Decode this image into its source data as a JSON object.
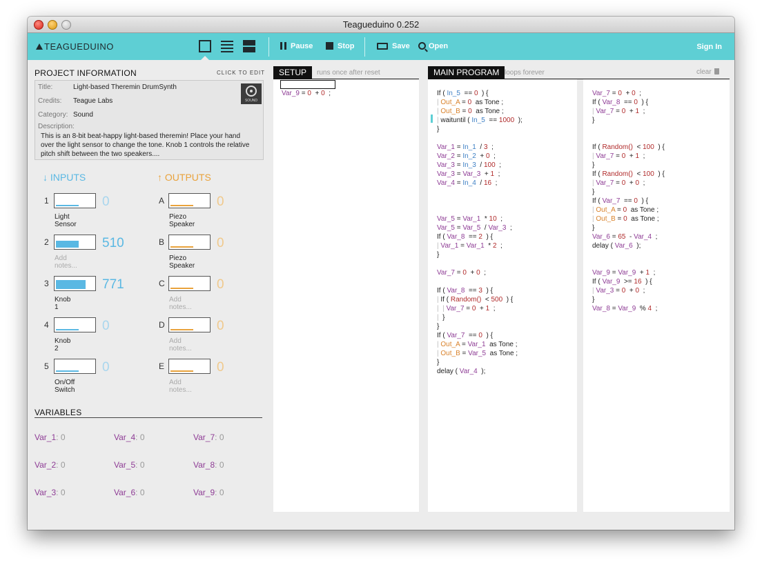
{
  "window": {
    "title": "Teagueduino 0.252"
  },
  "toolbar": {
    "logo": "TEAGUEDUINO",
    "pause": "Pause",
    "stop": "Stop",
    "save": "Save",
    "open": "Open",
    "signin": "Sign In",
    "icons": [
      "view-single-icon",
      "view-list-icon",
      "view-split-icon",
      "pause-icon",
      "stop-icon",
      "keyboard-icon",
      "search-icon"
    ]
  },
  "project": {
    "heading": "PROJECT INFORMATION",
    "edit_link": "CLICK TO EDIT",
    "title_label": "Title:",
    "title": "Light-based Theremin DrumSynth",
    "credits_label": "Credits:",
    "credits": "Teague Labs",
    "category_label": "Category:",
    "category": "Sound",
    "description_label": "Description:",
    "description": "This is an 8-bit beat-happy light-based theremin! Place your hand over the light sensor to change the tone. Knob 1 controls the relative pitch shift between the two speakers....",
    "category_icon_label": "SOUND"
  },
  "inputs": {
    "heading": "↓ INPUTS",
    "items": [
      {
        "id": "1",
        "value": "0",
        "fill": 0,
        "note": "Light Sensor",
        "note_set": true
      },
      {
        "id": "2",
        "value": "510",
        "fill": 0.5,
        "note": "Add notes...",
        "note_set": false
      },
      {
        "id": "3",
        "value": "771",
        "fill": 0.75,
        "note": "Knob 1",
        "note_set": true
      },
      {
        "id": "4",
        "value": "0",
        "fill": 0,
        "note": "Knob 2",
        "note_set": true
      },
      {
        "id": "5",
        "value": "0",
        "fill": 0,
        "note": "On/Off Switch",
        "note_set": true
      }
    ]
  },
  "outputs": {
    "heading": "↑ OUTPUTS",
    "items": [
      {
        "id": "A",
        "value": "0",
        "note": "Piezo Speaker",
        "note_set": true
      },
      {
        "id": "B",
        "value": "0",
        "note": "Piezo Speaker",
        "note_set": true
      },
      {
        "id": "C",
        "value": "0",
        "note": "Add notes...",
        "note_set": false
      },
      {
        "id": "D",
        "value": "0",
        "note": "Add notes...",
        "note_set": false
      },
      {
        "id": "E",
        "value": "0",
        "note": "Add notes...",
        "note_set": false
      }
    ]
  },
  "variables": {
    "heading": "VARIABLES",
    "items": [
      {
        "name": "Var_1",
        "value": "0"
      },
      {
        "name": "Var_4",
        "value": "0"
      },
      {
        "name": "Var_7",
        "value": "0"
      },
      {
        "name": "Var_2",
        "value": "0"
      },
      {
        "name": "Var_5",
        "value": "0"
      },
      {
        "name": "Var_8",
        "value": "0"
      },
      {
        "name": "Var_3",
        "value": "0"
      },
      {
        "name": "Var_6",
        "value": "0"
      },
      {
        "name": "Var_9",
        "value": "0"
      }
    ]
  },
  "setup": {
    "tab": "SETUP",
    "subtitle": "runs once after reset",
    "lines": [
      "<span class='p'>Var_9</span> = <span class='n'>0</span>  + <span class='n'>0</span>  ;"
    ]
  },
  "main": {
    "tab": "MAIN PROGRAM",
    "subtitle": "loops forever",
    "clear": "clear"
  },
  "main_col1": [
    "If ( <span class='b'>In_5</span>  == <span class='n'>0</span>  ) {",
    "<span class='g'>|</span> <span class='o'>Out_A</span> = <span class='n'>0</span>  as Tone ;",
    "<span class='g'>|</span> <span class='o'>Out_B</span> = <span class='n'>0</span>  as Tone ;",
    "<span class='g'>|</span> waituntil ( <span class='b'>In_5</span>  == <span class='n'>1000</span>  );",
    "}",
    "",
    "<span class='p'>Var_1</span> = <span class='b'>In_1</span>  / <span class='n'>3</span>  ;",
    "<span class='p'>Var_2</span> = <span class='b'>In_2</span>  + <span class='n'>0</span>  ;",
    "<span class='p'>Var_3</span> = <span class='b'>In_3</span>  / <span class='n'>100</span>  ;",
    "<span class='p'>Var_3</span> = <span class='p'>Var_3</span>  + <span class='n'>1</span>  ;",
    "<span class='p'>Var_4</span> = <span class='b'>In_4</span>  / <span class='n'>16</span>  ;",
    "",
    "",
    "",
    "<span class='p'>Var_5</span> = <span class='p'>Var_1</span>  * <span class='n'>10</span>  ;",
    "<span class='p'>Var_5</span> = <span class='p'>Var_5</span>  / <span class='p'>Var_3</span>  ;",
    "If ( <span class='p'>Var_8</span>  == <span class='n'>2</span>  ) {",
    "<span class='g'>|</span> <span class='p'>Var_1</span> = <span class='p'>Var_1</span>  * <span class='n'>2</span>  ;",
    "}",
    "",
    "<span class='p'>Var_7</span> = <span class='n'>0</span>  + <span class='n'>0</span>  ;",
    "",
    "If ( <span class='p'>Var_8</span>  == <span class='n'>3</span>  ) {",
    "<span class='g'>|</span> If ( <span class='n'>Random()</span>  &lt; <span class='n'>500</span>  ) {",
    "<span class='g'>|</span>  <span class='g'>|</span> <span class='p'>Var_7</span> = <span class='n'>0</span>  + <span class='n'>1</span>  ;",
    "<span class='g'>|</span>  }",
    "}",
    "If ( <span class='p'>Var_7</span>  == <span class='n'>0</span>  ) {",
    "<span class='g'>|</span> <span class='o'>Out_A</span> = <span class='p'>Var_1</span>  as Tone ;",
    "<span class='g'>|</span> <span class='o'>Out_B</span> = <span class='p'>Var_5</span>  as Tone ;",
    "}",
    "delay ( <span class='p'>Var_4</span>  );"
  ],
  "main_col2": [
    "<span class='p'>Var_7</span> = <span class='n'>0</span>  + <span class='n'>0</span>  ;",
    "If ( <span class='p'>Var_8</span>  == <span class='n'>0</span>  ) {",
    "<span class='g'>|</span> <span class='p'>Var_7</span> = <span class='n'>0</span>  + <span class='n'>1</span>  ;",
    "}",
    "",
    "",
    "If ( <span class='n'>Random()</span>  &lt; <span class='n'>100</span>  ) {",
    "<span class='g'>|</span> <span class='p'>Var_7</span> = <span class='n'>0</span>  + <span class='n'>1</span>  ;",
    "}",
    "If ( <span class='n'>Random()</span>  &lt; <span class='n'>100</span>  ) {",
    "<span class='g'>|</span> <span class='p'>Var_7</span> = <span class='n'>0</span>  + <span class='n'>0</span>  ;",
    "}",
    "If ( <span class='p'>Var_7</span>  == <span class='n'>0</span>  ) {",
    "<span class='g'>|</span> <span class='o'>Out_A</span> = <span class='n'>0</span>  as Tone ;",
    "<span class='g'>|</span> <span class='o'>Out_B</span> = <span class='n'>0</span>  as Tone ;",
    "}",
    "<span class='p'>Var_6</span> = <span class='n'>65</span>  - <span class='p'>Var_4</span>  ;",
    "delay ( <span class='p'>Var_6</span>  );",
    "",
    "",
    "<span class='p'>Var_9</span> = <span class='p'>Var_9</span>  + <span class='n'>1</span>  ;",
    "If ( <span class='p'>Var_9</span>  &gt;= <span class='n'>16</span>  ) {",
    "<span class='g'>|</span> <span class='p'>Var_3</span> = <span class='n'>0</span>  + <span class='n'>0</span>  ;",
    "}",
    "<span class='p'>Var_8</span> = <span class='p'>Var_9</span>  % <span class='n'>4</span>  ;"
  ]
}
